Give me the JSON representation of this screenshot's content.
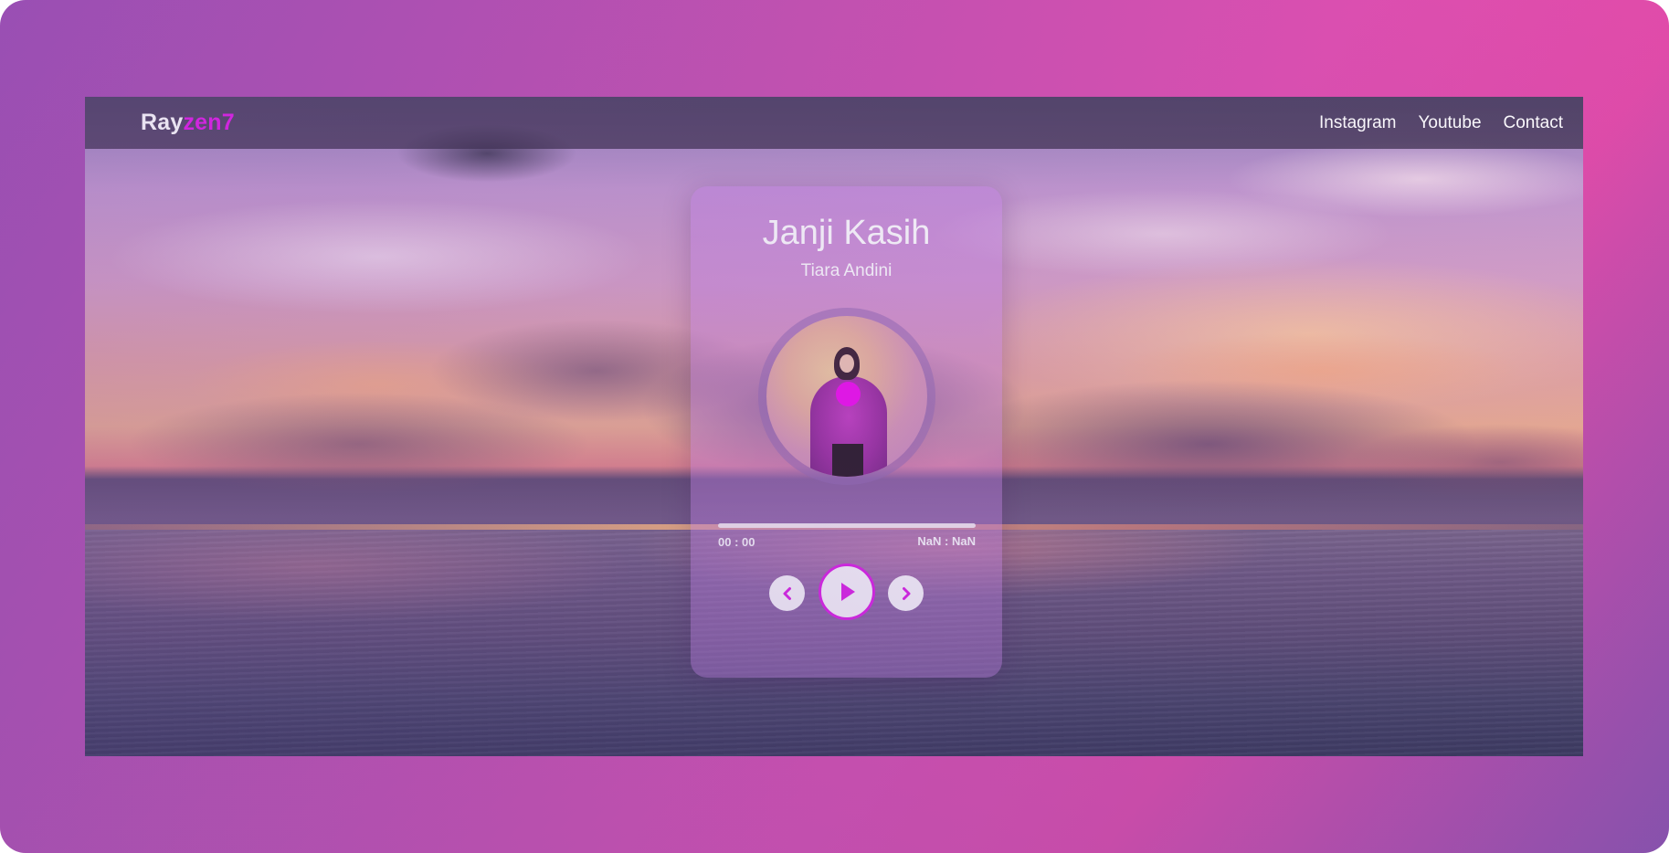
{
  "brand": {
    "prefix": "Ray",
    "accent": "zen7",
    "accent_color": "#e01ee8"
  },
  "nav": {
    "links": [
      {
        "label": "Instagram"
      },
      {
        "label": "Youtube"
      },
      {
        "label": "Contact"
      }
    ]
  },
  "player": {
    "title": "Janji Kasih",
    "artist": "Tiara Andini",
    "current_time": "00 : 00",
    "duration": "NaN : NaN",
    "progress": 0,
    "controls": {
      "prev_icon": "chevron-left-icon",
      "play_icon": "play-icon",
      "next_icon": "chevron-right-icon"
    },
    "accent_color": "#f20df0"
  }
}
